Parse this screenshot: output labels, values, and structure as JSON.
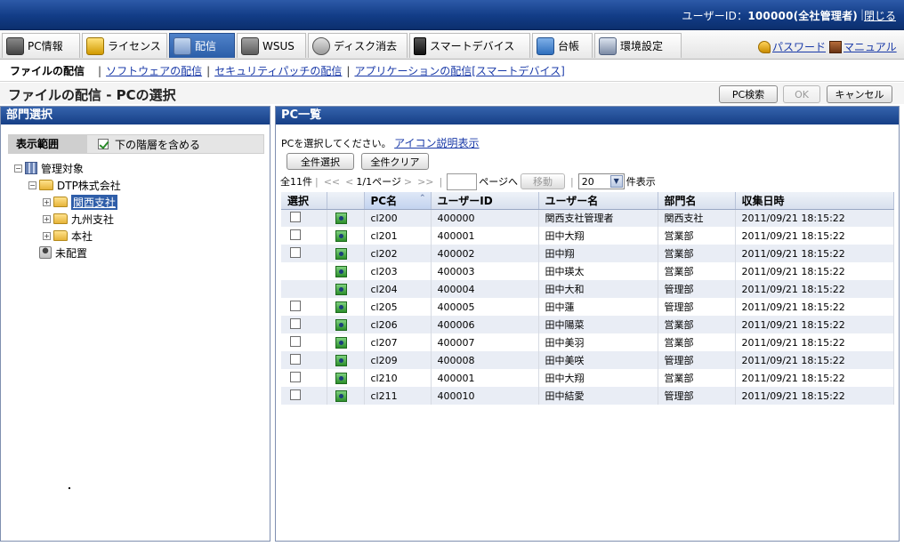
{
  "header": {
    "user_label": "ユーザーID：",
    "user_value": "100000(全社管理者)",
    "logout": "閉じる"
  },
  "nav": {
    "tabs": [
      {
        "label": "PC情報",
        "icon": "pc-icon"
      },
      {
        "label": "ライセンス",
        "icon": "license-icon"
      },
      {
        "label": "配信",
        "icon": "distribution-icon",
        "active": true
      },
      {
        "label": "WSUS",
        "icon": "wsus-icon"
      },
      {
        "label": "ディスク消去",
        "icon": "disk-erase-icon"
      },
      {
        "label": "スマートデバイス",
        "icon": "smart-device-icon"
      },
      {
        "label": "台帳",
        "icon": "ledger-icon"
      },
      {
        "label": "環境設定",
        "icon": "settings-icon"
      }
    ],
    "password": "パスワード",
    "manual": "マニュアル"
  },
  "subnav": {
    "current": "ファイルの配信",
    "links": [
      "ソフトウェアの配信",
      "セキュリティパッチの配信",
      "アプリケーションの配信[スマートデバイス]"
    ]
  },
  "page": {
    "title": "ファイルの配信 - PCの選択",
    "pc_search": "PC検索",
    "ok": "OK",
    "cancel": "キャンセル"
  },
  "left": {
    "title": "部門選択",
    "scope_label": "表示範囲",
    "include_lower": "下の階層を含める",
    "tree": {
      "root": "管理対象",
      "company": "DTP株式会社",
      "branches": [
        "関西支社",
        "九州支社",
        "本社"
      ],
      "unassigned": "未配置"
    }
  },
  "right": {
    "title": "PC一覧",
    "instruction": "PCを選択してください。",
    "icon_help": "アイコン説明表示",
    "select_all": "全件選択",
    "clear_all": "全件クリア",
    "pager": {
      "total": "全11件",
      "first": "<<",
      "prev": "<",
      "page_info": "1/1ページ",
      "next": ">",
      "last": ">>",
      "goto_suffix": "ページへ",
      "move": "移動",
      "per_page": "20",
      "per_page_suffix": "件表示"
    },
    "columns": [
      "選択",
      "",
      "PC名",
      "ユーザーID",
      "ユーザー名",
      "部門名",
      "収集日時"
    ],
    "rows": [
      {
        "checkbox": true,
        "pc": "cl200",
        "uid": "400000",
        "uname": "関西支社管理者",
        "dept": "関西支社",
        "date": "2011/09/21 18:15:22"
      },
      {
        "checkbox": true,
        "pc": "cl201",
        "uid": "400001",
        "uname": "田中大翔",
        "dept": "営業部",
        "date": "2011/09/21 18:15:22"
      },
      {
        "checkbox": true,
        "pc": "cl202",
        "uid": "400002",
        "uname": "田中翔",
        "dept": "営業部",
        "date": "2011/09/21 18:15:22"
      },
      {
        "checkbox": false,
        "pc": "cl203",
        "uid": "400003",
        "uname": "田中瑛太",
        "dept": "営業部",
        "date": "2011/09/21 18:15:22"
      },
      {
        "checkbox": false,
        "pc": "cl204",
        "uid": "400004",
        "uname": "田中大和",
        "dept": "管理部",
        "date": "2011/09/21 18:15:22"
      },
      {
        "checkbox": true,
        "pc": "cl205",
        "uid": "400005",
        "uname": "田中蓮",
        "dept": "管理部",
        "date": "2011/09/21 18:15:22"
      },
      {
        "checkbox": true,
        "pc": "cl206",
        "uid": "400006",
        "uname": "田中陽菜",
        "dept": "営業部",
        "date": "2011/09/21 18:15:22"
      },
      {
        "checkbox": true,
        "pc": "cl207",
        "uid": "400007",
        "uname": "田中美羽",
        "dept": "営業部",
        "date": "2011/09/21 18:15:22"
      },
      {
        "checkbox": true,
        "pc": "cl209",
        "uid": "400008",
        "uname": "田中美咲",
        "dept": "管理部",
        "date": "2011/09/21 18:15:22"
      },
      {
        "checkbox": true,
        "pc": "cl210",
        "uid": "400001",
        "uname": "田中大翔",
        "dept": "営業部",
        "date": "2011/09/21 18:15:22"
      },
      {
        "checkbox": true,
        "pc": "cl211",
        "uid": "400010",
        "uname": "田中結愛",
        "dept": "管理部",
        "date": "2011/09/21 18:15:22"
      }
    ]
  }
}
